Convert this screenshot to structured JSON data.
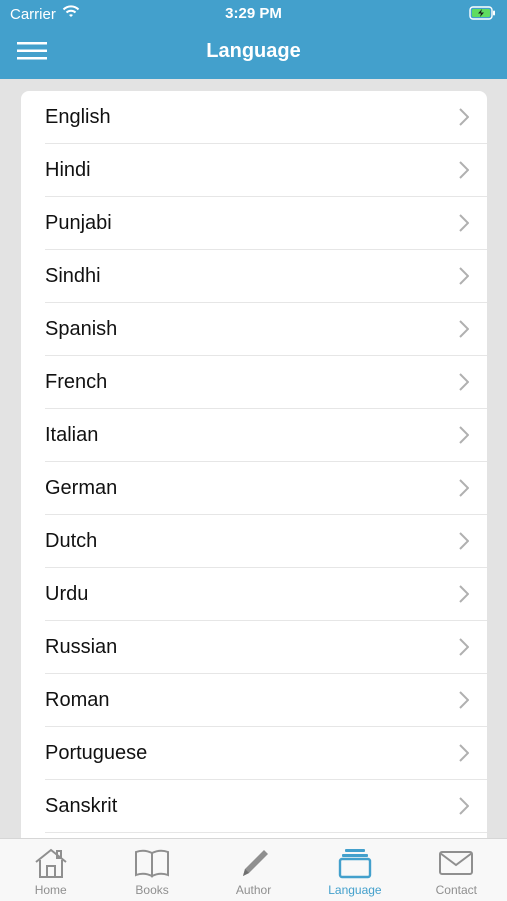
{
  "status_bar": {
    "carrier": "Carrier",
    "time": "3:29 PM",
    "icons": [
      "wifi-icon",
      "battery-charging-icon"
    ]
  },
  "navbar": {
    "title": "Language",
    "menu_icon": "hamburger-icon"
  },
  "languages": [
    "English",
    "Hindi",
    "Punjabi",
    "Sindhi",
    "Spanish",
    "French",
    "Italian",
    "German",
    "Dutch",
    "Urdu",
    "Russian",
    "Roman",
    "Portuguese",
    "Sanskrit"
  ],
  "tabbar": {
    "active": "Language",
    "tabs": [
      {
        "label": "Home",
        "icon": "home-icon"
      },
      {
        "label": "Books",
        "icon": "book-icon"
      },
      {
        "label": "Author",
        "icon": "pencil-icon"
      },
      {
        "label": "Language",
        "icon": "layers-icon"
      },
      {
        "label": "Contact",
        "icon": "envelope-icon"
      }
    ]
  },
  "colors": {
    "header": "#43a0cc",
    "active_tab": "#43a0cc",
    "inactive_tab": "#8f8f8f",
    "background": "#e3e3e3"
  }
}
